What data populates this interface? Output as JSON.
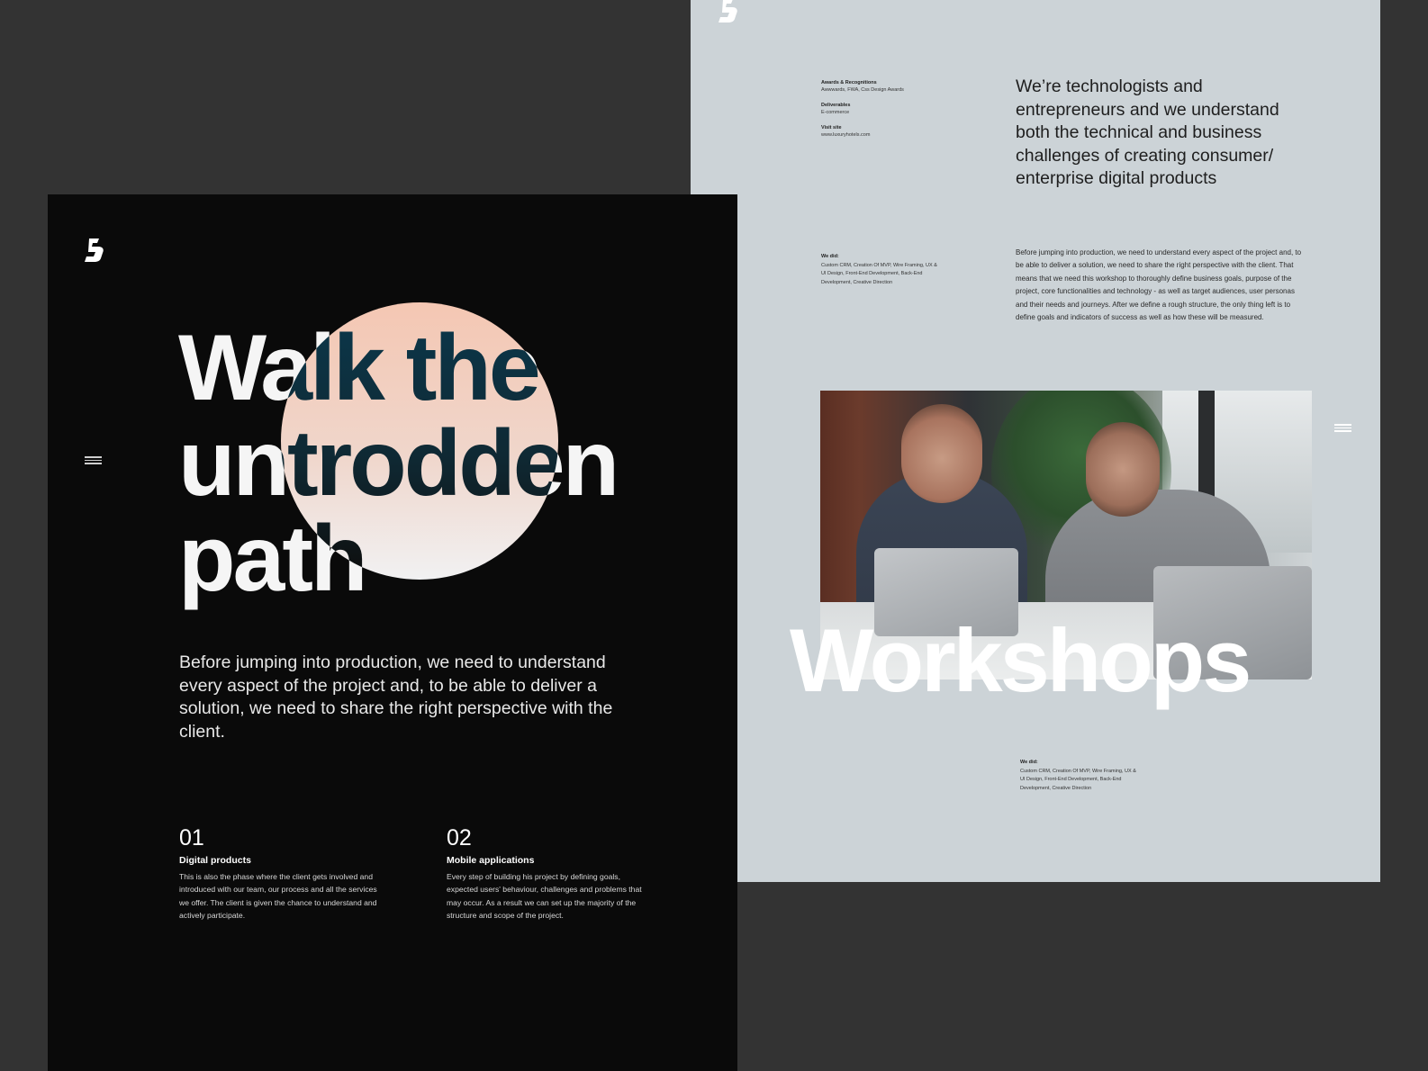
{
  "light_panel": {
    "logo": "b-logo-icon",
    "meta": [
      {
        "label": "Awards & Recognitions",
        "value": "Awwwards, FWA, Css Design Awards"
      },
      {
        "label": "Deliverables",
        "value": "E-commerce"
      },
      {
        "label": "Visit site",
        "value": "www.luxuryhotels.com"
      }
    ],
    "heading": "We’re technologists and entrepreneurs and we understand both the technical and business challenges of creating consumer/ enterprise digital products",
    "we_did_1": {
      "label": "We did:",
      "value": "Custom CRM, Creation Of MVP, Wire Framing, UX & UI Design, Front-End Development, Back-End Development, Creative Direction"
    },
    "body": "Before jumping into production, we need to understand every aspect of the project and, to be able to deliver a solution, we need to share the right perspective with the client. That means that we need this workshop to thoroughly define business goals, purpose of the project, core functionalities and technology - as well as target audiences, user personas and their needs and journeys. After we define a rough structure, the only thing left is to define goals and indicators of success as well as how these will be measured.",
    "photo_title": "Workshops",
    "we_did_2": {
      "label": "We did:",
      "value": "Custom CRM, Creation Of MVP, Wire Framing, UX & UI Design, Front-End Development, Back-End Development, Creative Direction"
    },
    "menu_icon": "hamburger-menu-icon"
  },
  "dark_panel": {
    "logo": "b-logo-icon",
    "menu_icon": "hamburger-menu-icon",
    "hero_lines": [
      "Walk the",
      "untrodden",
      "path"
    ],
    "subtitle": "Before jumping into production, we need to understand every aspect of the project and, to be able to deliver a solution, we need to share the right perspective with the client.",
    "features": [
      {
        "number": "01",
        "title": "Digital products",
        "text": "This is also the phase where the client gets involved and introduced with our team, our process and all the services we offer. The client is given the chance to understand and actively participate."
      },
      {
        "number": "02",
        "title": "Mobile applications",
        "text": "Every step of building his project by defining goals, expected users' behaviour, challenges and problems that may occur. As a result we can set up the majority of the structure and scope of the project."
      }
    ]
  },
  "colors": {
    "background": "#333333",
    "light_panel": "#ccd3d7",
    "dark_panel": "#0a0a0a",
    "orb_top": "#f4c7b3",
    "orb_bottom": "#f1f1f2"
  }
}
